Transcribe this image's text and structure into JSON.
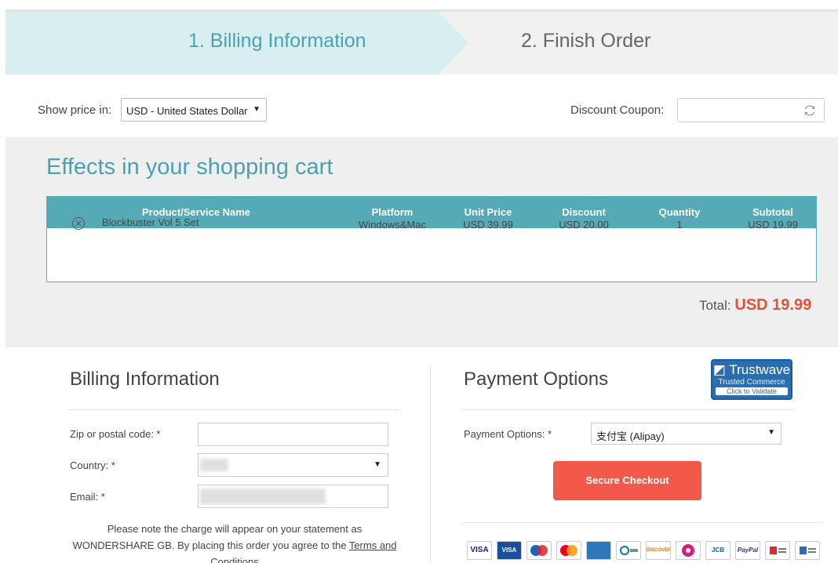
{
  "steps": {
    "step1": "1. Billing Information",
    "step2": "2. Finish Order"
  },
  "options": {
    "show_price_label": "Show price in:",
    "currency_selected": "USD - United States Dollar",
    "coupon_label": "Discount Coupon:",
    "coupon_value": ""
  },
  "cart": {
    "title": "Effects in your shopping cart",
    "columns": [
      "Product/Service Name",
      "Platform",
      "Unit Price",
      "Discount",
      "Quantity",
      "Subtotal"
    ],
    "rows": [
      {
        "name": "Blockbuster Vol 5 Set",
        "platform": "Windows&Mac",
        "unit_price": "USD 39.99",
        "discount": "USD 20.00",
        "quantity": "1",
        "subtotal": "USD 19.99"
      }
    ],
    "total_label": "Total:",
    "total_value": "USD 19.99"
  },
  "billing": {
    "title": "Billing Information",
    "zip_label": "Zip or postal code: *",
    "country_label": "Country: *",
    "email_label": "Email: *",
    "note_text": "Please note the charge will appear on your statement as WONDERSHARE GB. By placing this order you agree to the",
    "note_link": "Terms and Conditions"
  },
  "payment": {
    "title": "Payment Options",
    "label": "Payment Options: *",
    "selected": "支付宝 (Alipay)",
    "checkout_label": "Secure Checkout",
    "trust": {
      "name": "Trustwave",
      "sub": "Trusted Commerce",
      "click": "Click to Validate"
    },
    "cards": [
      {
        "name": "visa-icon",
        "text": "VISA"
      },
      {
        "name": "visa-electron-icon",
        "text": "VISA"
      },
      {
        "name": "maestro-icon",
        "text": ""
      },
      {
        "name": "mastercard-icon",
        "text": ""
      },
      {
        "name": "amex-icon",
        "text": ""
      },
      {
        "name": "diners-icon",
        "text": ""
      },
      {
        "name": "discover-icon",
        "text": "DISCOVER"
      },
      {
        "name": "jcb-like-icon",
        "text": ""
      },
      {
        "name": "jcb-icon",
        "text": "JCB"
      },
      {
        "name": "paypal-icon",
        "text": "PayPal"
      },
      {
        "name": "wire-transfer-icon",
        "text": ""
      },
      {
        "name": "bank-transfer-icon",
        "text": ""
      }
    ]
  },
  "colors": {
    "accent": "#4aa2b0",
    "table_header": "#56a9b6",
    "total": "#e2513c",
    "checkout": "#f2594b"
  }
}
